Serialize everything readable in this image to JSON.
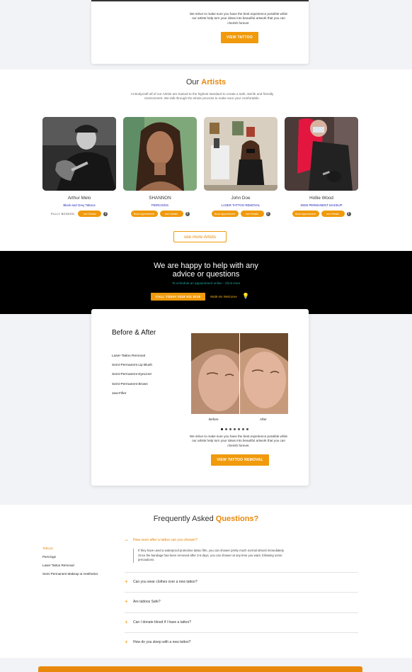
{
  "top_card": {
    "text": "We strive to make sure you have the best experience possible while our artists help turn your ideas into beautiful artwork that you can cherish forever.",
    "button": "VIEW TATTOO"
  },
  "artists_section": {
    "title_plain": "Our",
    "title_accent": "Artists",
    "intro": "At Bodycraft all of our Artists are trained to the highest standard to create a safe, sterile and friendly environment. We talk through the whole process to make sure your comfortable.",
    "artists": [
      {
        "name": "Arthur Melo",
        "role": "Black and Grey Tattoos",
        "status": "FULLY BOOKED",
        "book": "",
        "info": "see Details"
      },
      {
        "name": "SHANNON",
        "role": "PIERCINGS",
        "status": "",
        "book": "Book Appointment",
        "info": "see Details"
      },
      {
        "name": "John Doe",
        "role": "LASER TATTOO REMOVAL",
        "status": "",
        "book": "Book Appointment",
        "info": "see Details"
      },
      {
        "name": "Hollie Wood",
        "role": "SEMI PERMANENT MAKEUP",
        "status": "",
        "book": "Book Appointment",
        "info": "see Details"
      }
    ],
    "see_more": "see more Artists"
  },
  "help": {
    "title_line1": "We are happy to help with any",
    "title_line2": "advice or questions",
    "sub": "To schedule an appointment online - Click Here",
    "call": "CALL TODAY 0118 911 8118",
    "walkins": "Walk-ins Welcome"
  },
  "before_after": {
    "title": "Before & After",
    "items": [
      "Laser-Tattoo Removal",
      "Semi-Permanent Lip Blush",
      "Semi-Permanent EyeLiner",
      "Semi-Permanent Brows",
      "Jaw-Filler"
    ],
    "before_label": "Before",
    "after_label": "After",
    "text": "We strive to make sure you have the best experience possible while our artists help turn your ideas into beautiful artwork that you can cherish forever.",
    "button": "VIEW TATTOO REMOVAL"
  },
  "faq": {
    "title_plain": "Frequently Asked",
    "title_accent": "Questions?",
    "categories": [
      "Tattoos",
      "Piercings",
      "Laser Tattoo Removal",
      "Semi Permanent Makeup & Aesthetics"
    ],
    "open_question": "How soon after a tattoo can you shower?",
    "open_answer": "If they have used a waterproof protective tattoo film, you can shower pretty much normal almost immediately. Once the bandage has been removed after 3-5 days, you can shower at any time you want, following some precautions.",
    "questions": [
      "Can you wear clothes over a new tattoo?",
      "Are tattoos Safe?",
      "Can I donate blood if I have a tattoo?",
      "How do you sleep with a new tattoo?"
    ]
  },
  "colors": {
    "accent": "#f09a0c",
    "dark": "#000000",
    "link": "#2424b8"
  }
}
